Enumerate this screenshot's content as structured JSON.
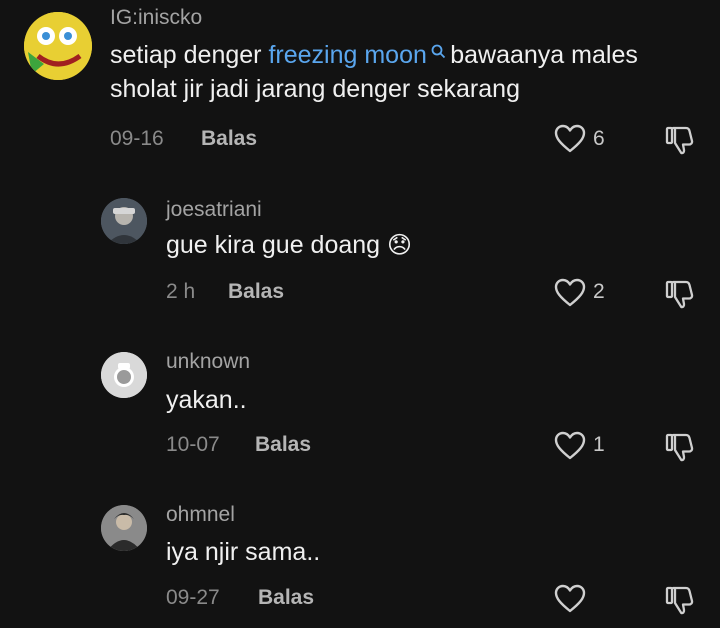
{
  "comments": [
    {
      "username": "IG:iniscko",
      "text_before": "setiap denger ",
      "link": "freezing moon",
      "link_icon": "search-icon",
      "text_after": " bawaanya males sholat jir jadi jarang denger sekarang",
      "time": "09-16",
      "reply_label": "Balas",
      "likes": "6"
    },
    {
      "username": "joesatriani",
      "text": "gue kira gue doang",
      "emoji": "😞",
      "time": "2 h",
      "reply_label": "Balas",
      "likes": "2"
    },
    {
      "username": "unknown",
      "text": "yakan..",
      "time": "10-07",
      "reply_label": "Balas",
      "likes": "1"
    },
    {
      "username": "ohmnel",
      "text": "iya njir sama..",
      "time": "09-27",
      "reply_label": "Balas",
      "likes": ""
    }
  ]
}
